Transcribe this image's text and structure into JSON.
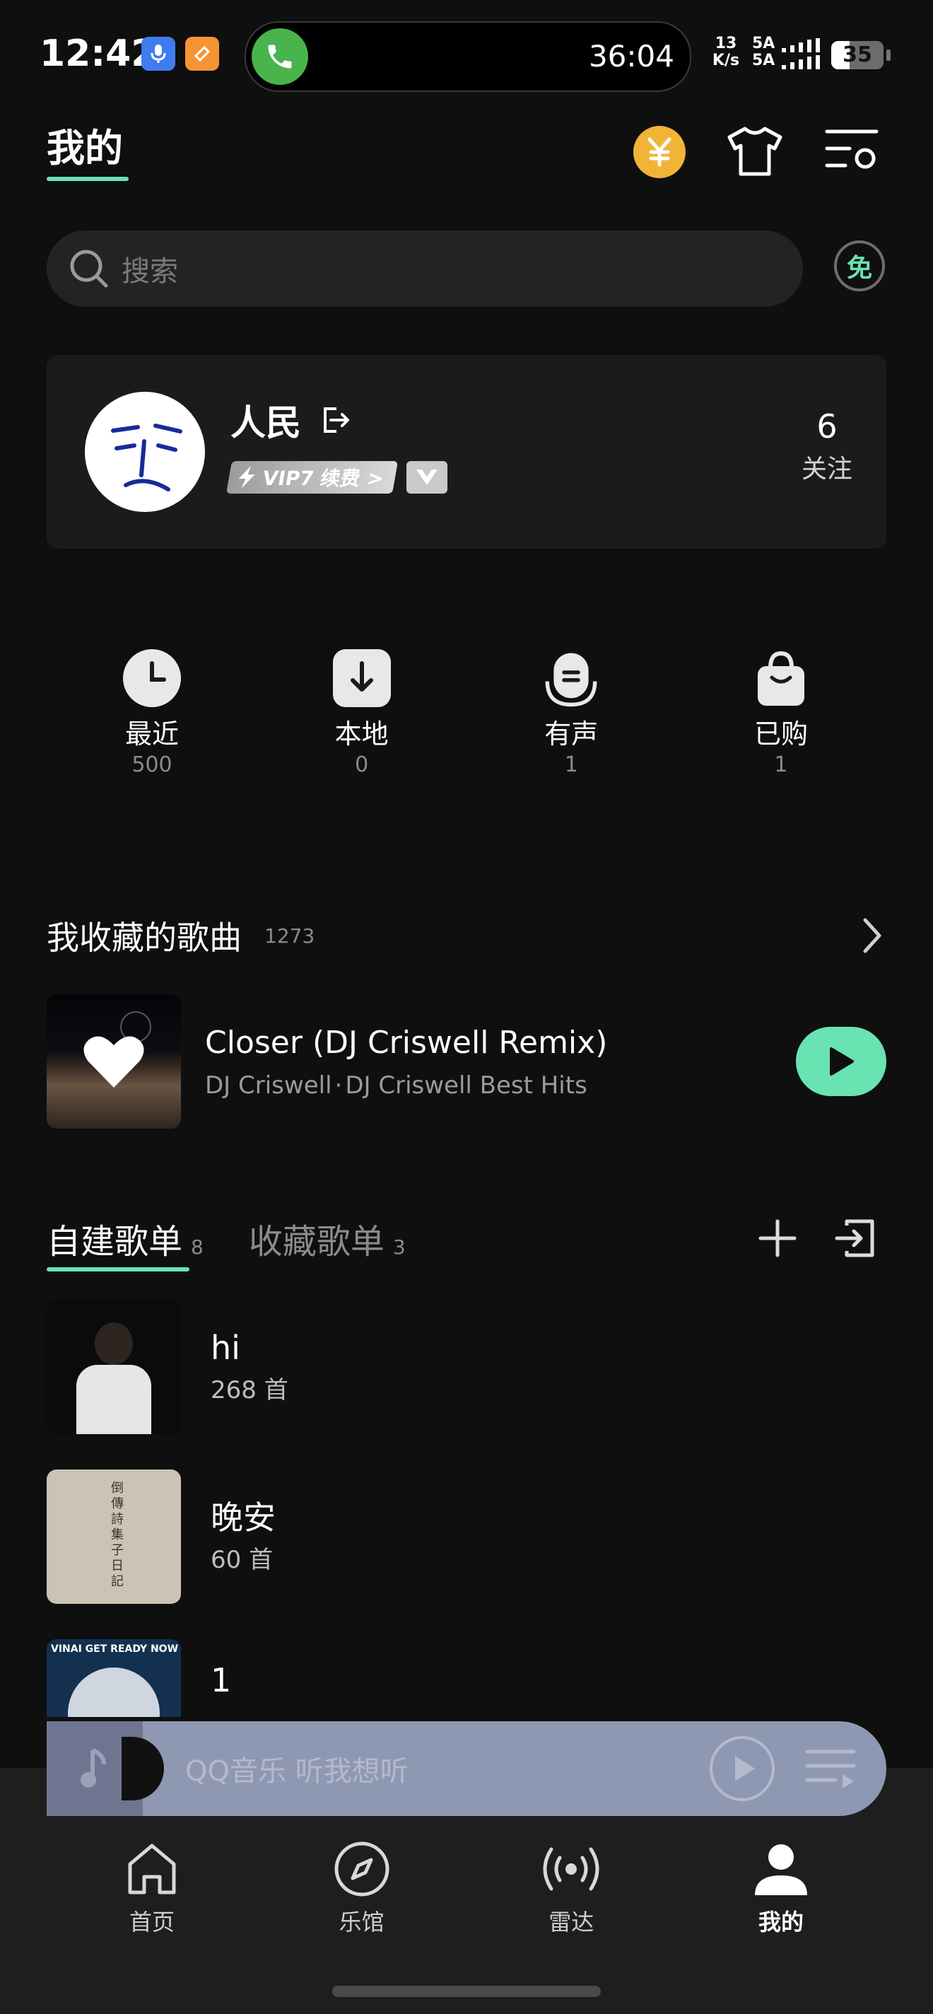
{
  "status_bar": {
    "time": "12:42",
    "call_timer": "36:04",
    "net_speed_top": "13",
    "net_speed_bottom": "K/s",
    "signal_label_top": "5A",
    "signal_label_bottom": "5A",
    "battery": "35"
  },
  "header": {
    "title": "我的",
    "icons": [
      "yen-coin-icon",
      "tshirt-icon",
      "settings-list-icon"
    ]
  },
  "search": {
    "placeholder": "搜索",
    "free_badge": "免"
  },
  "profile": {
    "name": "人民",
    "vip_badge": "VIP7 续费 >",
    "follow_count": "6",
    "follow_label": "关注"
  },
  "quick_access": [
    {
      "label": "最近",
      "count": "500",
      "icon": "clock-icon"
    },
    {
      "label": "本地",
      "count": "0",
      "icon": "download-icon"
    },
    {
      "label": "有声",
      "count": "1",
      "icon": "audiobook-icon"
    },
    {
      "label": "已购",
      "count": "1",
      "icon": "shopping-bag-icon"
    }
  ],
  "favorites": {
    "title": "我收藏的歌曲",
    "count": "1273",
    "song_title": "Closer (DJ Criswell Remix)",
    "song_artist": "DJ Criswell",
    "song_album": "DJ Criswell Best Hits",
    "separator": "·"
  },
  "playlists": {
    "tab_created": "自建歌单",
    "tab_created_count": "8",
    "tab_collected": "收藏歌单",
    "tab_collected_count": "3",
    "items": [
      {
        "title": "hi",
        "subtitle": "268 首"
      },
      {
        "title": "晚安",
        "subtitle": "60 首"
      },
      {
        "title": "1",
        "subtitle": ""
      }
    ],
    "cover_texts": [
      "倒\n傳\n詩\n集\n子\n日\n記",
      "VINAI GET READY NOW"
    ]
  },
  "mini_player": {
    "text": "QQ音乐 听我想听"
  },
  "bottom_nav": [
    {
      "label": "首页",
      "icon": "home-icon"
    },
    {
      "label": "乐馆",
      "icon": "compass-icon"
    },
    {
      "label": "雷达",
      "icon": "radar-icon"
    },
    {
      "label": "我的",
      "icon": "profile-icon"
    }
  ],
  "colors": {
    "accent": "#69e3b2",
    "gold": "#f2b437",
    "background": "#0f0f0f",
    "card": "#1b1b1b",
    "mini_player": "#8f98b3"
  }
}
